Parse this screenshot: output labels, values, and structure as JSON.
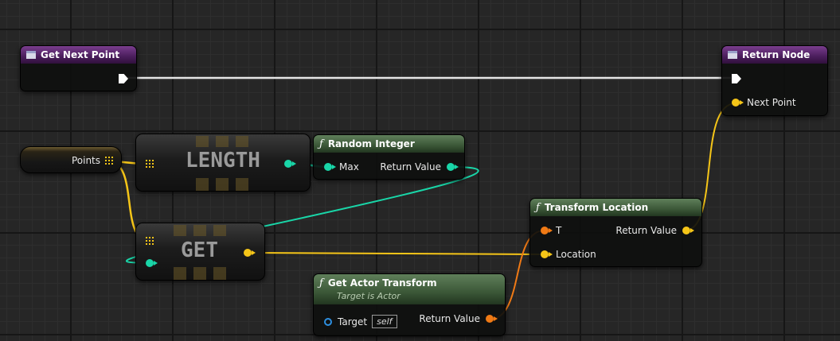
{
  "nodes": {
    "get_next_point": {
      "title": "Get Next Point"
    },
    "return_node": {
      "title": "Return Node",
      "pin_next_point": "Next Point"
    },
    "points_variable": {
      "label": "Points"
    },
    "length_node": {
      "title": "LENGTH"
    },
    "get_node": {
      "title": "GET"
    },
    "random_integer": {
      "title": "Random Integer",
      "pin_max": "Max",
      "pin_return": "Return Value"
    },
    "transform_location": {
      "title": "Transform Location",
      "pin_t": "T",
      "pin_location": "Location",
      "pin_return": "Return Value"
    },
    "get_actor_transform": {
      "title": "Get Actor Transform",
      "subtitle": "Target is Actor",
      "pin_target": "Target",
      "target_default": "self",
      "pin_return": "Return Value"
    }
  },
  "colors": {
    "exec": "#ffffff",
    "integer_pin": "#19d6a8",
    "vector_pin": "#f5c518",
    "transform_pin": "#f07a15",
    "object_pin": "#2d8fe0",
    "function_header": "#3b5737",
    "entry_header": "#4e2060"
  },
  "icons": [
    "function-icon",
    "entry-node-icon",
    "exec-pin-icon",
    "array-pin-icon"
  ]
}
